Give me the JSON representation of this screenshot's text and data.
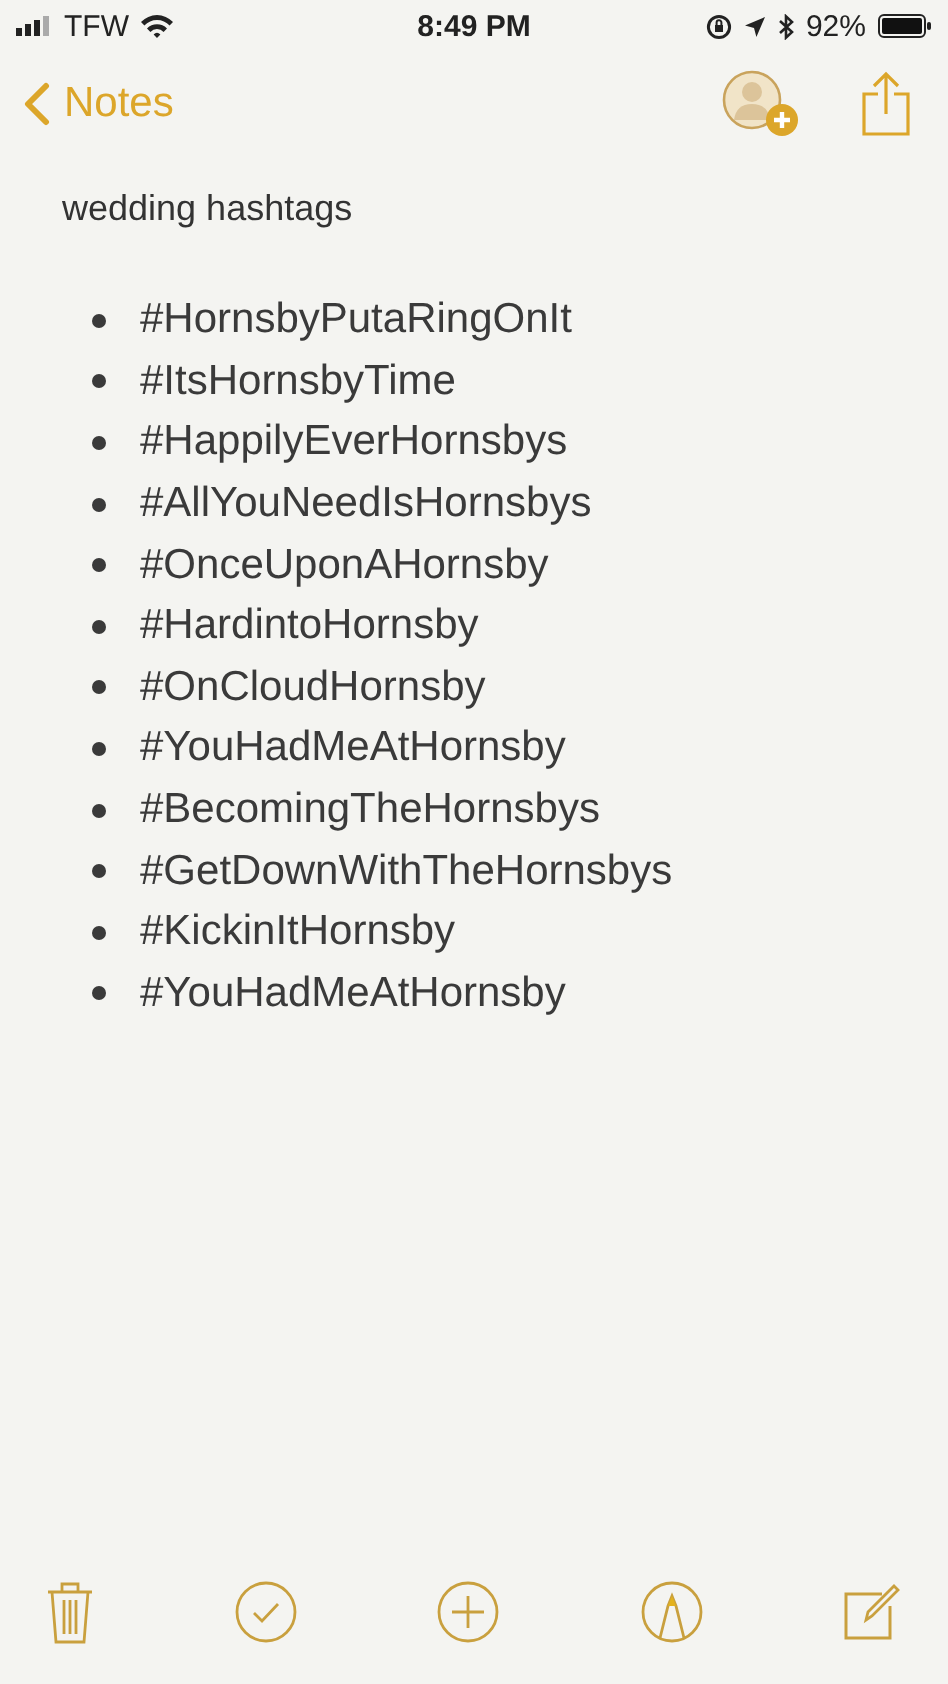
{
  "status_bar": {
    "carrier": "TFW",
    "time": "8:49 PM",
    "battery": "92%"
  },
  "nav": {
    "back_label": "Notes"
  },
  "note": {
    "title": "wedding hashtags",
    "items": [
      "#HornsbyPutaRingOnIt",
      "#ItsHornsbyTime",
      "#HappilyEverHornsbys",
      "#AllYouNeedIsHornsbys",
      "#OnceUponAHornsby",
      "#HardintoHornsby",
      "#OnCloudHornsby",
      "#YouHadMeAtHornsby",
      "#BecomingTheHornsbys",
      "#GetDownWithTheHornsbys",
      "#KickinItHornsby",
      "#YouHadMeAtHornsby"
    ]
  }
}
